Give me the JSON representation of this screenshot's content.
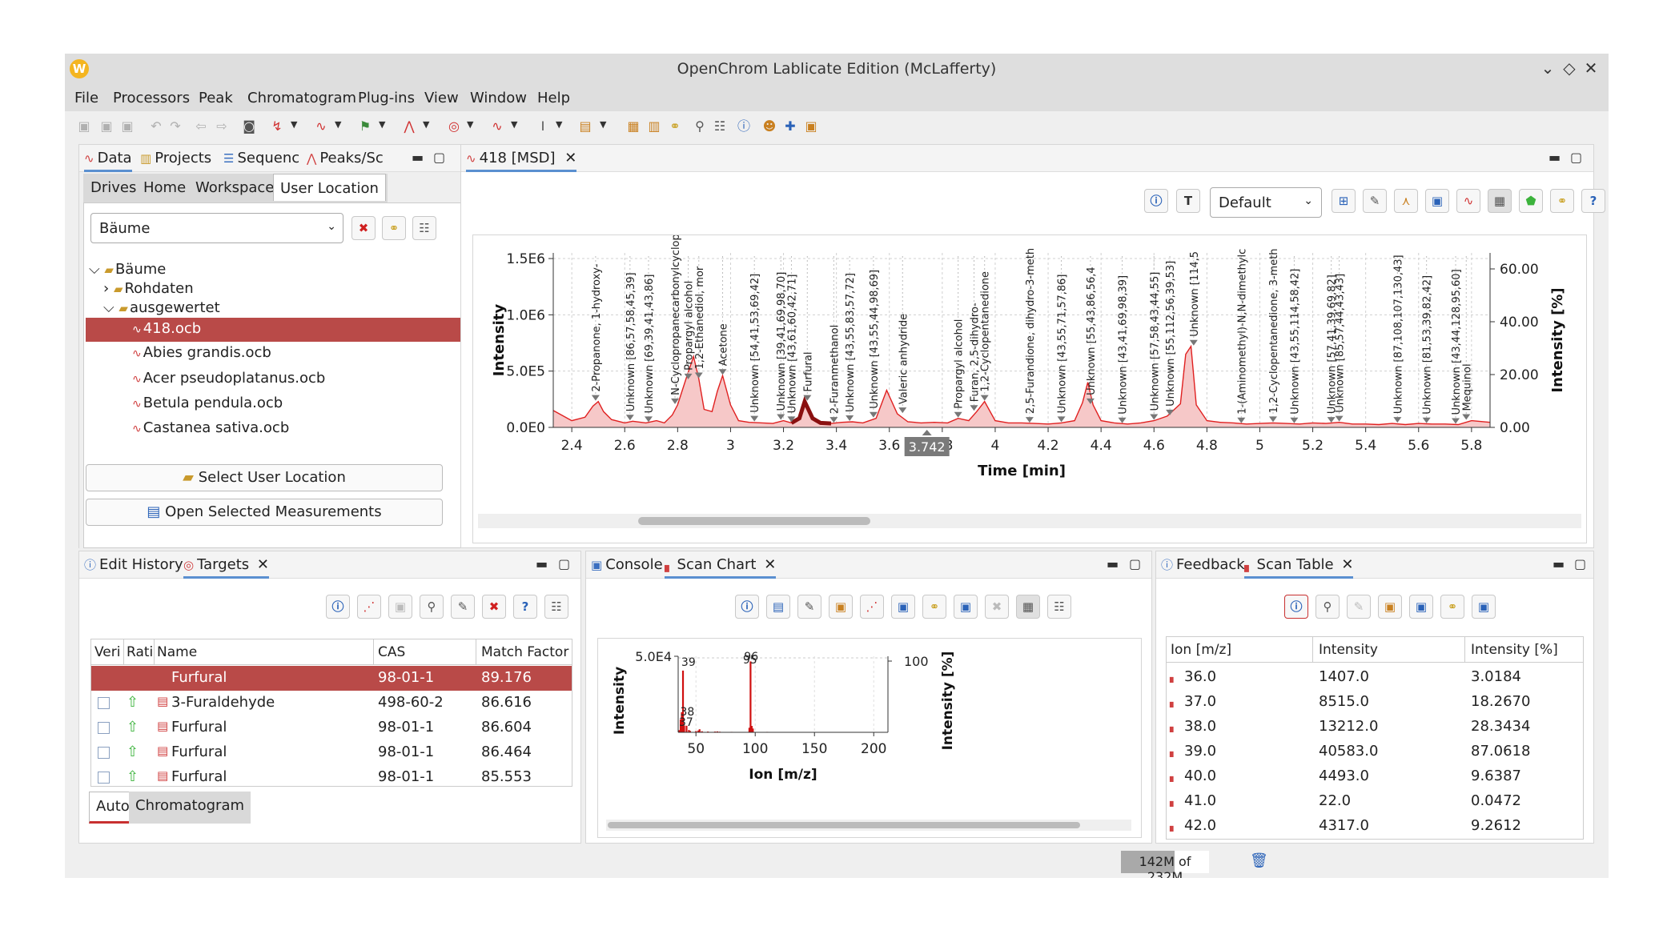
{
  "window": {
    "title": "OpenChrom Lablicate Edition (McLafferty)",
    "app_icon": "W",
    "controls": [
      "⌄",
      "◇",
      "✕"
    ]
  },
  "menu": [
    "File",
    "Processors",
    "Peak",
    "Chromatogram",
    "Plug-ins",
    "View",
    "Window",
    "Help"
  ],
  "left_panel": {
    "tabs": [
      "Data",
      "Projects",
      "Sequenc",
      "Peaks/Sc"
    ],
    "subtabs": [
      "Drives",
      "Home",
      "Workspace",
      "User Location"
    ],
    "location_value": "Bäume",
    "tree": [
      {
        "label": "Bäume",
        "type": "folder",
        "level": 0,
        "expanded": true
      },
      {
        "label": "Rohdaten",
        "type": "folder",
        "level": 1,
        "expanded": false
      },
      {
        "label": "ausgewertet",
        "type": "folder",
        "level": 1,
        "expanded": true
      },
      {
        "label": "418.ocb",
        "type": "file",
        "level": 2,
        "selected": true
      },
      {
        "label": "Abies grandis.ocb",
        "type": "file",
        "level": 2
      },
      {
        "label": "Acer pseudoplatanus.ocb",
        "type": "file",
        "level": 2
      },
      {
        "label": "Betula pendula.ocb",
        "type": "file",
        "level": 2
      },
      {
        "label": "Castanea sativa.ocb",
        "type": "file",
        "level": 2
      }
    ],
    "select_button": "Select User Location",
    "open_button": "Open Selected Measurements"
  },
  "editor": {
    "tab": "418 [MSD]",
    "preset": "Default",
    "cursor_time": "3.742",
    "chart_data": {
      "type": "line",
      "xlabel": "Time [min]",
      "ylabel": "Intensity",
      "ylabel_right": "Intensity [%]",
      "x_ticks": [
        "2.4",
        "2.6",
        "2.8",
        "3",
        "3.2",
        "3.4",
        "3.6",
        "3.8",
        "4",
        "4.2",
        "4.4",
        "4.6",
        "4.8",
        "5",
        "5.2",
        "5.4",
        "5.6",
        "5.8"
      ],
      "y_ticks": [
        "1.5E6",
        "1.0E6",
        "5.0E5",
        "0.0E0"
      ],
      "y_ticks_right": [
        "60.00",
        "40.00",
        "20.00",
        "0.00"
      ],
      "xlim": [
        2.33,
        5.87
      ],
      "ylim": [
        0,
        1550000
      ],
      "series": [
        {
          "x": [
            2.33,
            2.4,
            2.45,
            2.48,
            2.5,
            2.52,
            2.55,
            2.6,
            2.63,
            2.68,
            2.72,
            2.75,
            2.78,
            2.8,
            2.83,
            2.86,
            2.88,
            2.9,
            2.93,
            2.95,
            2.97,
            3.0,
            3.03,
            3.07,
            3.12,
            3.16,
            3.2,
            3.23,
            3.26,
            3.28,
            3.31,
            3.34,
            3.38,
            3.42,
            3.46,
            3.5,
            3.55,
            3.59,
            3.63,
            3.67,
            3.72,
            3.77,
            3.82,
            3.86,
            3.9,
            3.93,
            3.96,
            4.0,
            4.05,
            4.1,
            4.15,
            4.2,
            4.25,
            4.3,
            4.33,
            4.35,
            4.37,
            4.4,
            4.45,
            4.5,
            4.55,
            4.6,
            4.65,
            4.7,
            4.72,
            4.74,
            4.76,
            4.8,
            4.85,
            4.9,
            4.95,
            5.0,
            5.05,
            5.1,
            5.15,
            5.2,
            5.25,
            5.3,
            5.35,
            5.4,
            5.45,
            5.5,
            5.55,
            5.6,
            5.65,
            5.7,
            5.75,
            5.8,
            5.87
          ],
          "y": [
            150000,
            60000,
            90000,
            190000,
            230000,
            140000,
            70000,
            40000,
            55000,
            40000,
            60000,
            40000,
            110000,
            200000,
            420000,
            630000,
            430000,
            160000,
            140000,
            320000,
            460000,
            200000,
            60000,
            45000,
            40000,
            35000,
            60000,
            40000,
            80000,
            230000,
            80000,
            40000,
            35000,
            45000,
            50000,
            40000,
            80000,
            330000,
            120000,
            50000,
            40000,
            45000,
            40000,
            80000,
            60000,
            140000,
            230000,
            60000,
            40000,
            40000,
            35000,
            30000,
            40000,
            60000,
            220000,
            400000,
            200000,
            60000,
            40000,
            30000,
            40000,
            60000,
            100000,
            210000,
            650000,
            720000,
            200000,
            60000,
            45000,
            40000,
            30000,
            35000,
            40000,
            35000,
            30000,
            40000,
            35000,
            45000,
            30000,
            30000,
            25000,
            35000,
            25000,
            35000,
            30000,
            30000,
            25000,
            60000,
            45000
          ]
        }
      ],
      "thick_segment_x": [
        3.22,
        3.38
      ],
      "peak_labels": [
        {
          "x": 2.49,
          "text": "2-Propanone, 1-hydroxy-"
        },
        {
          "x": 2.62,
          "text": "Unknown [86,57,58,45,39]"
        },
        {
          "x": 2.69,
          "text": "Unknown [69,39,41,43,86]"
        },
        {
          "x": 2.79,
          "text": "N-Cyclopropanecarbonylcyclopr"
        },
        {
          "x": 2.84,
          "text": "Propargyl alcohol"
        },
        {
          "x": 2.88,
          "text": "1,2-Ethanediol, mor"
        },
        {
          "x": 2.97,
          "text": "Acetone"
        },
        {
          "x": 3.09,
          "text": "Unknown [54,41,53,69,42]"
        },
        {
          "x": 3.19,
          "text": "Unknown [39,41,69,98,70]"
        },
        {
          "x": 3.23,
          "text": "Unknown [43,61,60,42,71]"
        },
        {
          "x": 3.29,
          "text": "Furfural"
        },
        {
          "x": 3.39,
          "text": "2-Furanmethanol"
        },
        {
          "x": 3.45,
          "text": "Unknown [43,55,83,57,72]"
        },
        {
          "x": 3.54,
          "text": "Unknown [43,55,44,98,69]"
        },
        {
          "x": 3.65,
          "text": "Valeric anhydride"
        },
        {
          "x": 3.86,
          "text": "Propargyl alcohol"
        },
        {
          "x": 3.92,
          "text": "Furan, 2,5-dihydro-"
        },
        {
          "x": 3.96,
          "text": "1,2-Cyclopentanedione"
        },
        {
          "x": 4.13,
          "text": "2,5-Furandione, dihydro-3-meth"
        },
        {
          "x": 4.25,
          "text": "Unknown [43,55,71,57,86]"
        },
        {
          "x": 4.36,
          "text": "Unknown [55,43,86,56,4"
        },
        {
          "x": 4.48,
          "text": "Unknown [43,41,69,98,39]"
        },
        {
          "x": 4.6,
          "text": "Unknown [57,58,43,44,55]"
        },
        {
          "x": 4.66,
          "text": "Unknown [55,112,56,39,53]"
        },
        {
          "x": 4.75,
          "text": "Unknown [114,5"
        },
        {
          "x": 4.93,
          "text": "1-(Aminomethyl)-N,N-dimethylc"
        },
        {
          "x": 5.05,
          "text": "1,2-Cyclopentanedione, 3-meth"
        },
        {
          "x": 5.13,
          "text": "Unknown [43,55,114,58,42]"
        },
        {
          "x": 5.27,
          "text": "Unknown [57,41,39,69,82]"
        },
        {
          "x": 5.3,
          "text": "Unknown [85,57,44,43,43]"
        },
        {
          "x": 5.52,
          "text": "Unknown [87,108,107,130,43]"
        },
        {
          "x": 5.63,
          "text": "Unknown [81,53,39,82,42]"
        },
        {
          "x": 5.74,
          "text": "Unknown [43,44,128,95,60]"
        },
        {
          "x": 5.78,
          "text": "Mequinol"
        }
      ]
    }
  },
  "targets_panel": {
    "tabs": [
      "Edit History",
      "Targets"
    ],
    "columns": [
      "Veri",
      "Rati",
      "Name",
      "CAS",
      "Match Factor"
    ],
    "rows": [
      {
        "name": "Furfural",
        "cas": "98-01-1",
        "match": "89.176",
        "selected": true
      },
      {
        "name": "3-Furaldehyde",
        "cas": "498-60-2",
        "match": "86.616"
      },
      {
        "name": "Furfural",
        "cas": "98-01-1",
        "match": "86.604"
      },
      {
        "name": "Furfural",
        "cas": "98-01-1",
        "match": "86.464"
      },
      {
        "name": "Furfural",
        "cas": "98-01-1",
        "match": "85.553"
      }
    ],
    "bottom_tabs": [
      "Auto",
      "Chromatogram"
    ]
  },
  "scan_chart_panel": {
    "tabs": [
      "Console",
      "Scan Chart"
    ],
    "chart_data": {
      "type": "bar",
      "xlabel": "Ion [m/z]",
      "ylabel": "Intensity",
      "ylabel_right": "Intensity [%]",
      "x_ticks": [
        "50",
        "100",
        "150",
        "200"
      ],
      "y_ticks": [
        "5.0E4"
      ],
      "y_ticks_right": [
        "100"
      ],
      "xlim": [
        35,
        212
      ],
      "ylim": [
        0,
        50000
      ],
      "ions": [
        36,
        37,
        38,
        39,
        40,
        41,
        42,
        44,
        45,
        50,
        52,
        53,
        55,
        60,
        66,
        68,
        70,
        80,
        95,
        96,
        97,
        98,
        110
      ],
      "intensities": [
        1407,
        8515,
        13212,
        40583,
        4493,
        22,
        4317,
        1500,
        900,
        800,
        1200,
        2000,
        700,
        500,
        500,
        600,
        400,
        300,
        3000,
        46619,
        4200,
        2500,
        300
      ],
      "data_labels": [
        {
          "x": 39,
          "text": "39"
        },
        {
          "x": 38,
          "text": "38"
        },
        {
          "x": 37,
          "text": "37"
        },
        {
          "x": 96,
          "text": "96"
        },
        {
          "x": 95,
          "text": "95"
        }
      ]
    }
  },
  "scan_table_panel": {
    "tabs": [
      "Feedback",
      "Scan Table"
    ],
    "columns": [
      "Ion [m/z]",
      "Intensity",
      "Intensity [%]"
    ],
    "rows": [
      [
        "36.0",
        "1407.0",
        "3.0184"
      ],
      [
        "37.0",
        "8515.0",
        "18.2670"
      ],
      [
        "38.0",
        "13212.0",
        "28.3434"
      ],
      [
        "39.0",
        "40583.0",
        "87.0618"
      ],
      [
        "40.0",
        "4493.0",
        "9.6387"
      ],
      [
        "41.0",
        "22.0",
        "0.0472"
      ],
      [
        "42.0",
        "4317.0",
        "9.2612"
      ]
    ]
  },
  "status": {
    "memory": "142M of 232M",
    "memory_fraction": 0.61
  },
  "colors": {
    "selection": "#b94a48",
    "chromatogram_line": "#e02020",
    "chromatogram_fill": "#f6c8c8",
    "accent": "#5a8fd0"
  }
}
